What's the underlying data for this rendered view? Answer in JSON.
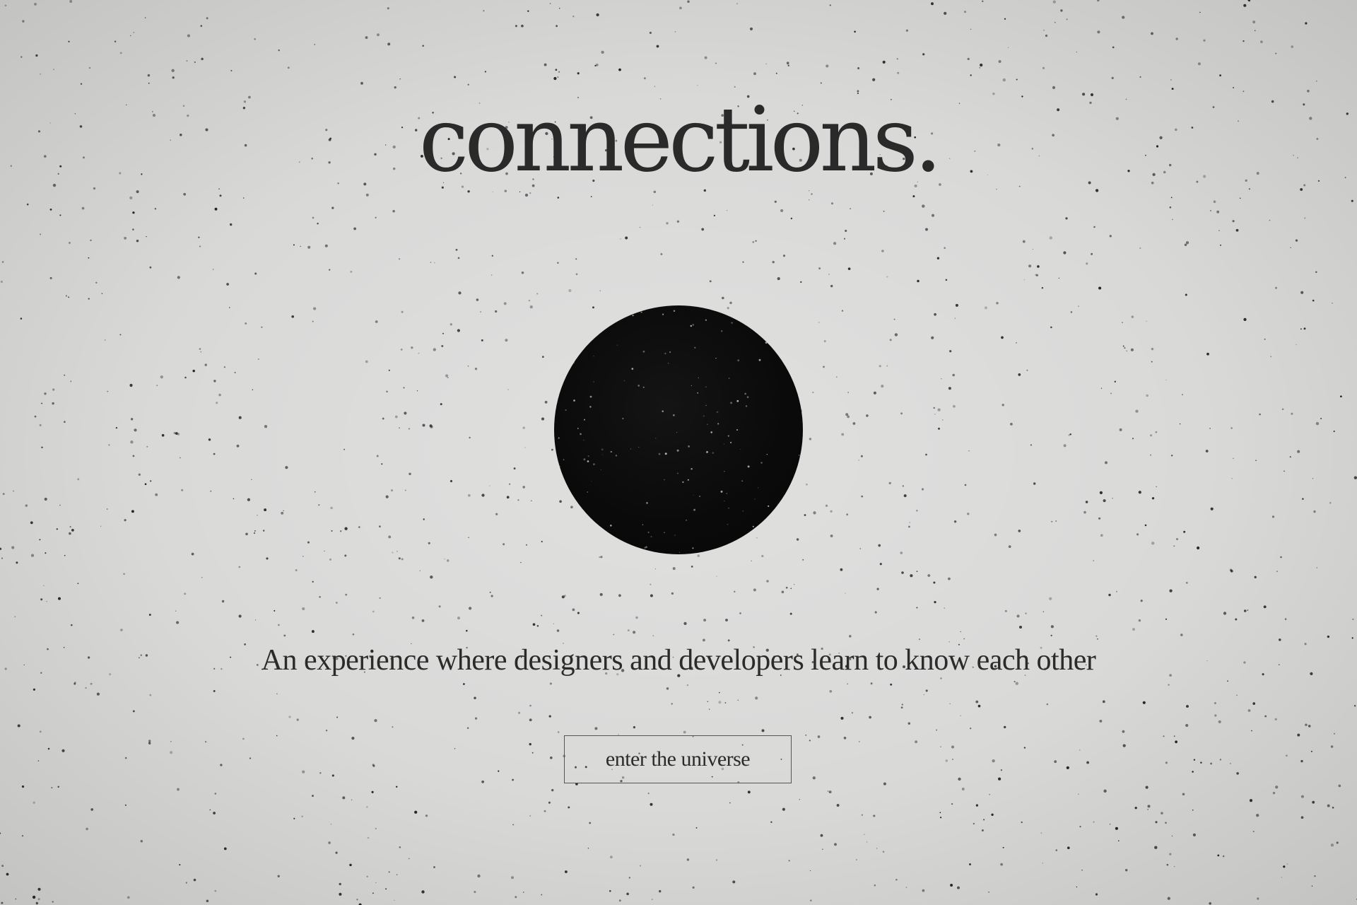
{
  "hero": {
    "title": "connections.",
    "tagline": "An experience where designers and developers learn to know each other"
  },
  "cta": {
    "label": "enter the universe"
  },
  "theme": {
    "background": "#d9d9d8",
    "ink": "#1c1c1c",
    "orb": "#0a0a0a"
  }
}
